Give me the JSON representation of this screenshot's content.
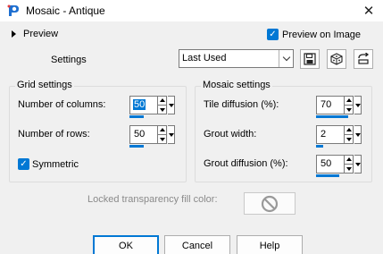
{
  "window": {
    "title": "Mosaic - Antique"
  },
  "preview": {
    "label": "Preview",
    "preview_on_image_label": "Preview on Image",
    "preview_on_image_checked": true
  },
  "settings": {
    "label": "Settings",
    "preset_value": "Last Used"
  },
  "grid": {
    "legend": "Grid settings",
    "columns_label": "Number of columns:",
    "columns_value": "50",
    "columns_slider_fraction": 0.5,
    "rows_label": "Number of rows:",
    "rows_value": "50",
    "rows_slider_fraction": 0.5,
    "symmetric_label": "Symmetric",
    "symmetric_checked": true
  },
  "mosaic": {
    "legend": "Mosaic settings",
    "tile_diffusion_label": "Tile diffusion (%):",
    "tile_diffusion_value": "70",
    "tile_diffusion_fraction": 0.7,
    "grout_width_label": "Grout width:",
    "grout_width_value": "2",
    "grout_width_fraction": 0.1,
    "grout_diffusion_label": "Grout diffusion (%):",
    "grout_diffusion_value": "50",
    "grout_diffusion_fraction": 0.5
  },
  "fill": {
    "label": "Locked transparency fill color:"
  },
  "buttons": {
    "ok": "OK",
    "cancel": "Cancel",
    "help": "Help"
  },
  "colors": {
    "accent": "#0078d4"
  }
}
